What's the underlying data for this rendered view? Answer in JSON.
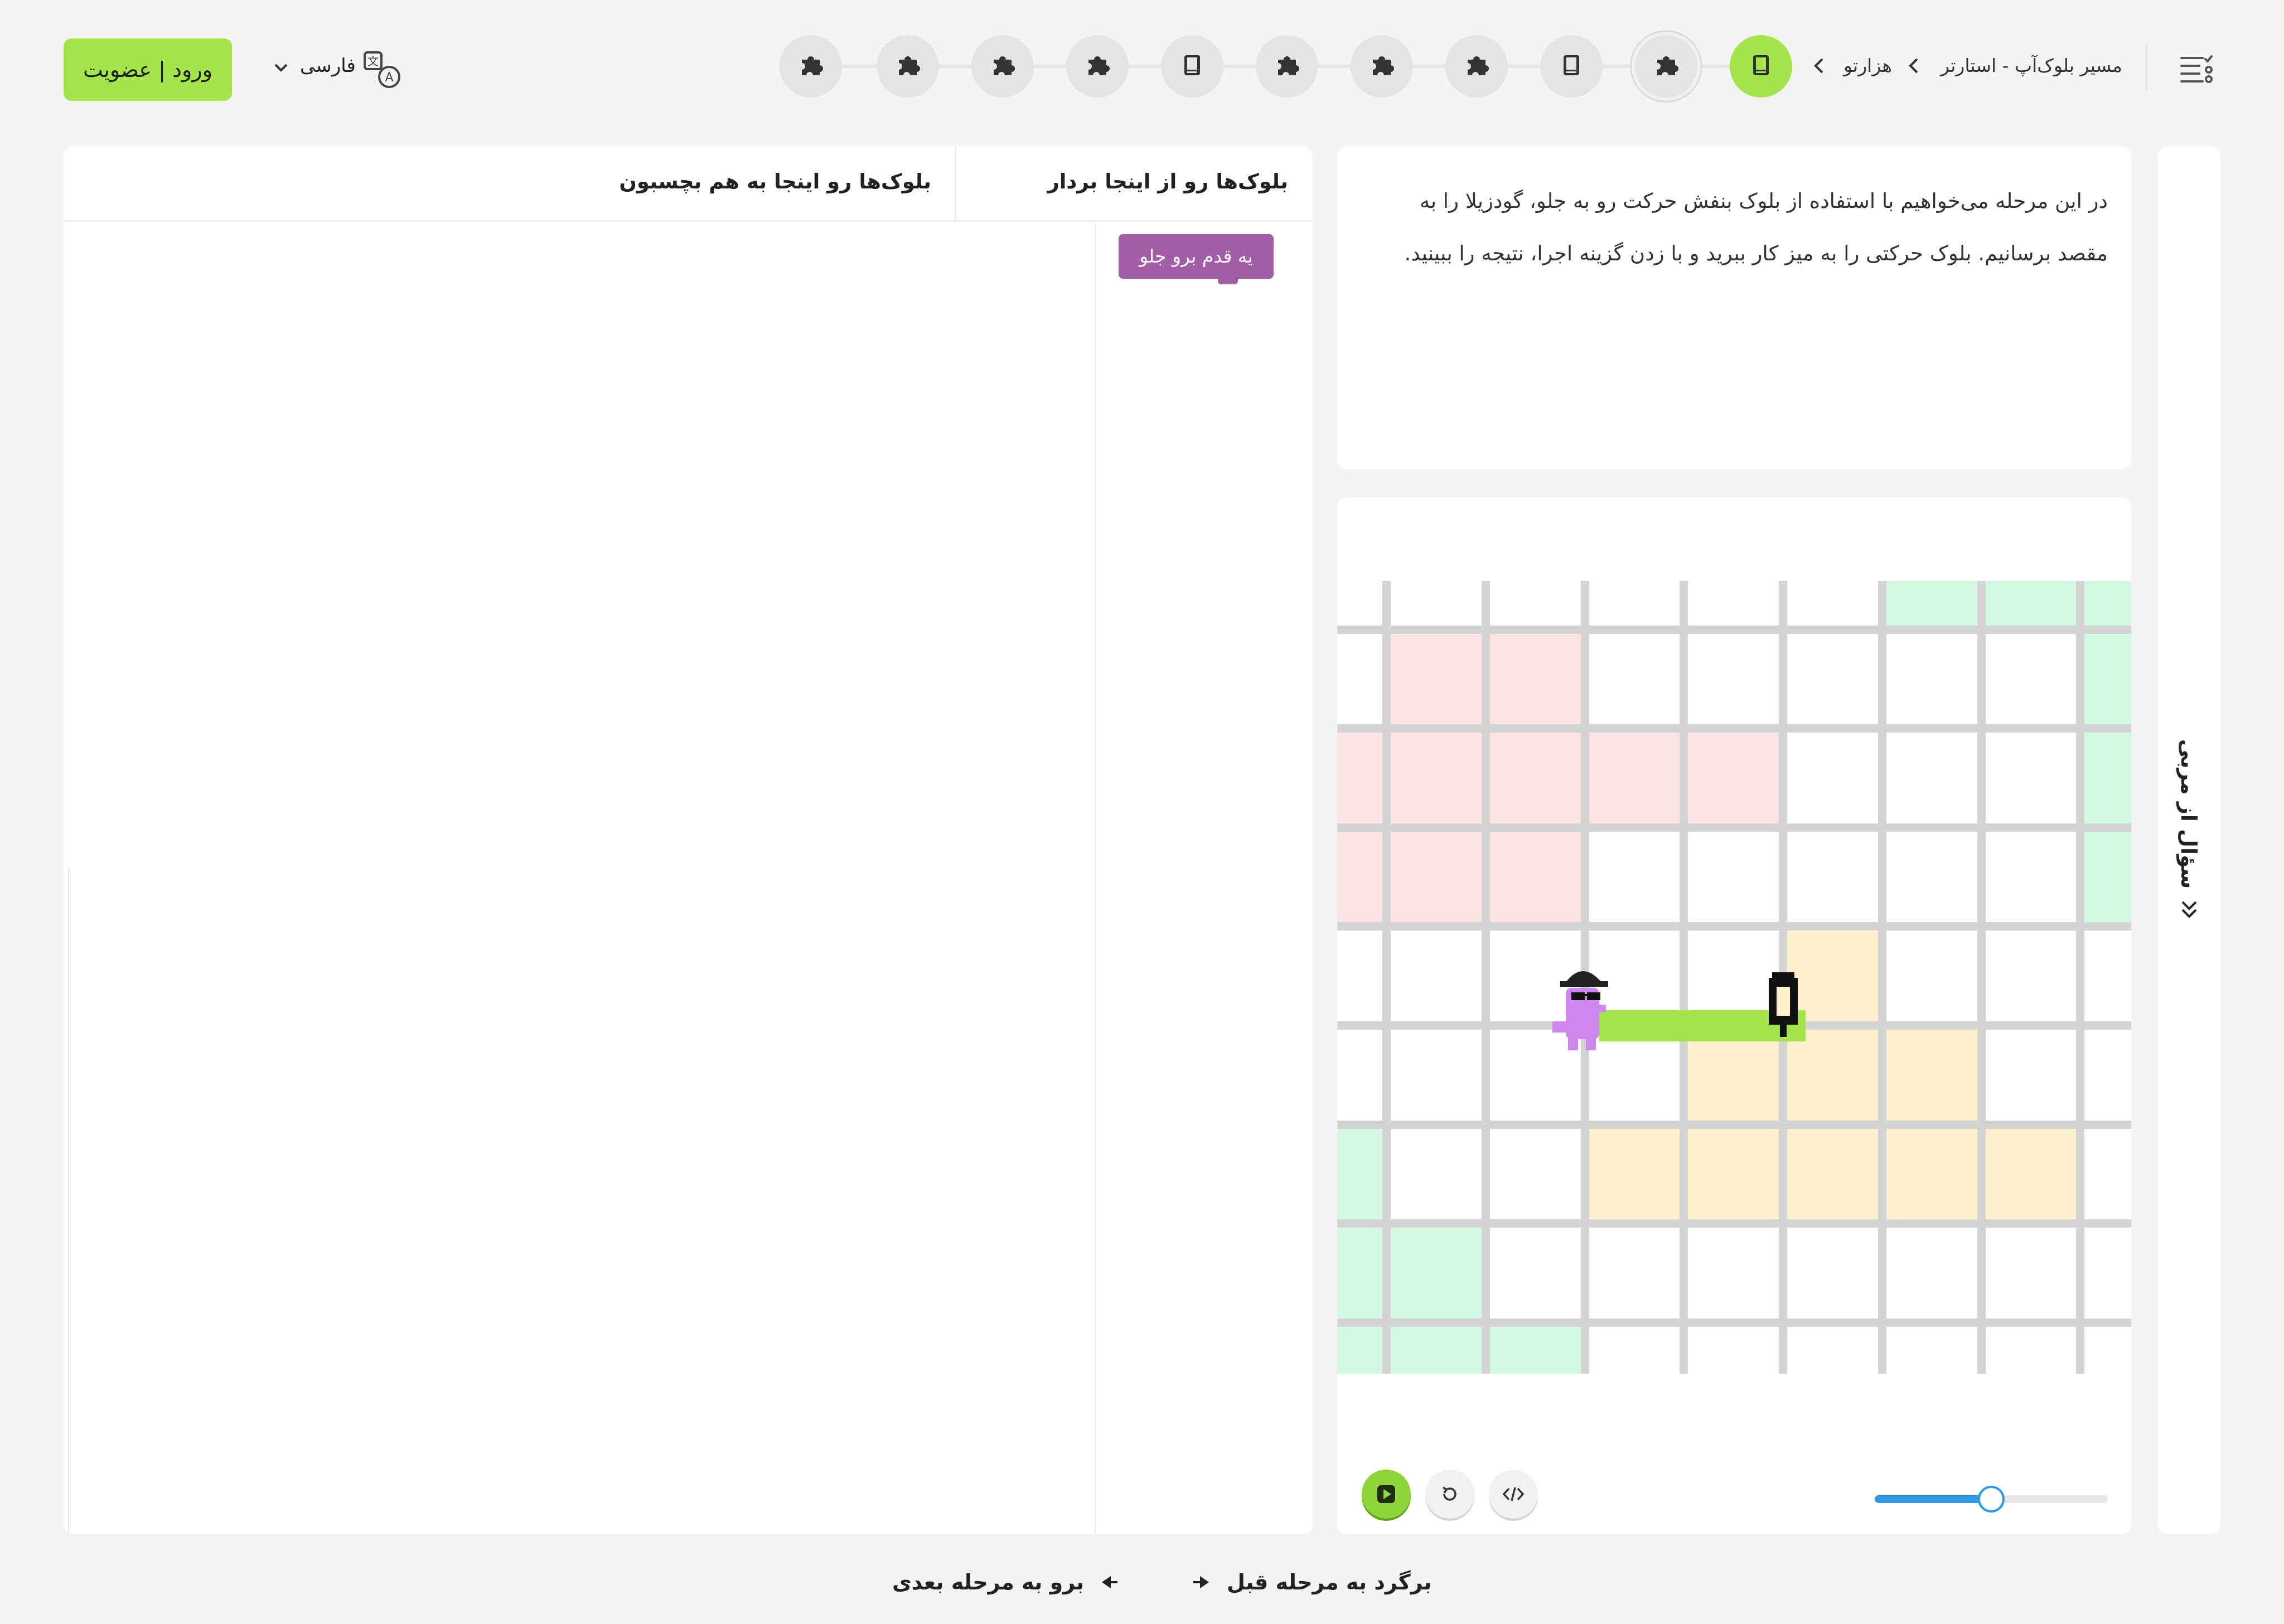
{
  "header": {
    "breadcrumb": [
      "مسیر بلوک‌آپ - استارتر",
      "هزارتو"
    ],
    "nodes": [
      {
        "icon": "book-icon",
        "active": true
      },
      {
        "icon": "puzzle-icon",
        "current": true
      },
      {
        "icon": "book-icon"
      },
      {
        "icon": "puzzle-icon"
      },
      {
        "icon": "puzzle-icon"
      },
      {
        "icon": "puzzle-icon"
      },
      {
        "icon": "book-icon"
      },
      {
        "icon": "puzzle-icon"
      },
      {
        "icon": "puzzle-icon"
      },
      {
        "icon": "puzzle-icon"
      },
      {
        "icon": "puzzle-icon"
      }
    ],
    "language": "فارسی",
    "login_label": "ورود | عضویت"
  },
  "side_rail": {
    "ask_label": "سؤال از مربی"
  },
  "description": {
    "text": "در این مرحله می‌خواهیم با استفاده از بلوک بنفش حرکت رو به جلو، گودزیلا را به مقصد برسانیم. بلوک حرکتی را به میز کار ببرید و با زدن گزینه اجرا، نتیجه را ببینید."
  },
  "workspace": {
    "toolbox_title": "بلوک‌ها رو از اینجا بردار",
    "workspace_title": "بلوک‌ها رو اینجا به هم بچسبون",
    "blocks": [
      {
        "label": "یه قدم برو جلو",
        "color": "#a15da6"
      }
    ]
  },
  "stage": {
    "colors": {
      "red": "#fde3e3",
      "green": "#d4f9e2",
      "yellow": "#fdf1cc",
      "path": "#a4e54c",
      "grid": "#d4d4d4"
    },
    "speed_fraction": 0.5
  },
  "footer": {
    "next_label": "برو به مرحله بعدی",
    "prev_label": "برگرد به مرحله قبل"
  },
  "colors": {
    "accent": "#a4e54c",
    "block_purple": "#a15da6",
    "slider": "#2e9ae6"
  }
}
